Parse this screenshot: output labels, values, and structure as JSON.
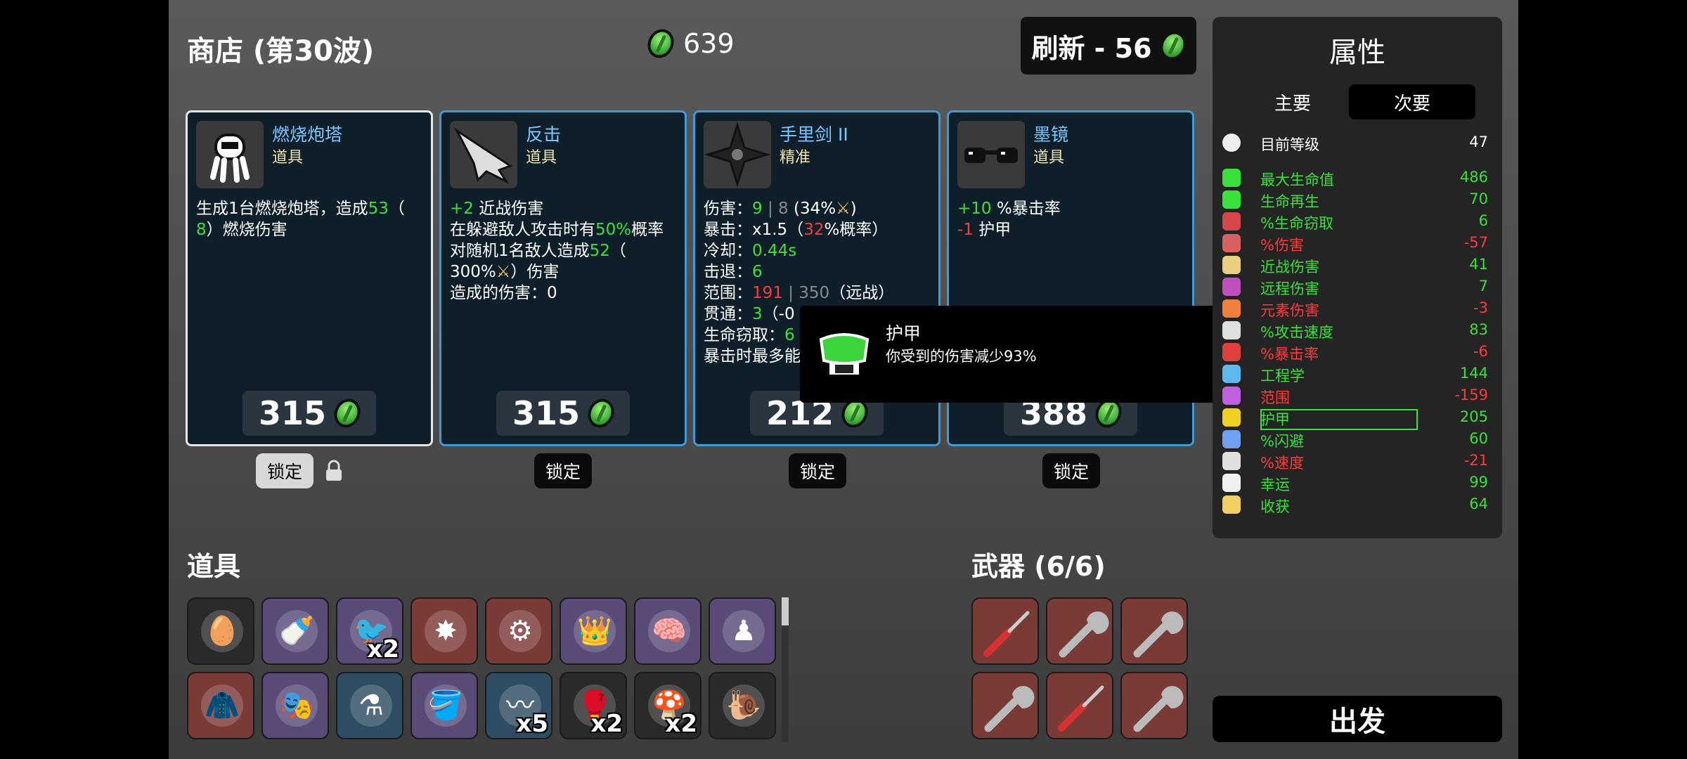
{
  "header": {
    "title": "商店 (第30波)",
    "money": "639",
    "refresh_label": "刷新 - 56"
  },
  "shop": [
    {
      "name": "燃烧炮塔",
      "type": "道具",
      "price": "315",
      "lock": "锁定",
      "desc": [
        [
          "生成1台燃烧炮塔，造成",
          ""
        ],
        [
          "53",
          "g"
        ],
        [
          "（",
          ""
        ],
        [
          "8",
          "g"
        ],
        [
          "）燃烧伤害",
          ""
        ]
      ]
    },
    {
      "name": "反击",
      "type": "道具",
      "price": "315",
      "lock": "锁定"
    },
    {
      "name": "手里剑 II",
      "type": "精准",
      "price": "212",
      "lock": "锁定"
    },
    {
      "name": "墨镜",
      "type": "道具",
      "price": "388",
      "lock": "锁定"
    }
  ],
  "card2": {
    "l1a": "+2",
    "l1b": " 近战伤害",
    "l2a": "在躲避敌人攻击时有",
    "l2b": "50%",
    "l2c": "概率",
    "l3a": "对随机1名敌人造成",
    "l3b": "52",
    "l3c": "（",
    "l4": "300%",
    "l4b": "）伤害",
    "l5": "造成的伤害：0"
  },
  "card3": {
    "dmg_label": "伤害：",
    "dmg": "9",
    "dmg_sep": " | ",
    "dmg_base": "8",
    "dmg_pct": " (34%",
    "crit_label": "暴击：",
    "crit_mult": "x1.5（",
    "crit_chance": "32",
    "crit_tail": "%概率）",
    "cd_label": "冷却：",
    "cd": "0.44s",
    "kb_label": "击退：",
    "kb": "6",
    "range_label": "范围：",
    "range": "191",
    "range_sep": " | ",
    "range_base": "350",
    "range_tail": "（远战）",
    "pierce_label": "贯通：",
    "pierce": "3",
    "pierce_tail": "（-0",
    "ls_label": "生命窃取：",
    "ls": "6",
    "crit_text": "暴击时最多能"
  },
  "card4": {
    "l1a": "+10",
    "l1b": " %暴击率",
    "l2a": "-1",
    "l2b": " 护甲"
  },
  "tooltip": {
    "title": "护甲",
    "desc": "你受到的伤害减少93%"
  },
  "stats": {
    "title": "属性",
    "tab_main": "主要",
    "tab_secondary": "次要",
    "level_label": "目前等级",
    "level": "47",
    "rows": [
      {
        "label": "最大生命值",
        "value": "486",
        "color": "#39e13d",
        "icon": "heart-icon",
        "ic": "#39e13d"
      },
      {
        "label": "生命再生",
        "value": "70",
        "color": "#39e13d",
        "icon": "regen-icon",
        "ic": "#39e13d"
      },
      {
        "label": "%生命窃取",
        "value": "6",
        "color": "#39e13d",
        "icon": "lifesteal-icon",
        "ic": "#d8454a"
      },
      {
        "label": "%伤害",
        "value": "-57",
        "color": "#ff3a3a",
        "icon": "damage-icon",
        "ic": "#d86060"
      },
      {
        "label": "近战伤害",
        "value": "41",
        "color": "#39e13d",
        "icon": "melee-icon",
        "ic": "#e8d080"
      },
      {
        "label": "远程伤害",
        "value": "7",
        "color": "#39e13d",
        "icon": "ranged-icon",
        "ic": "#c050c0"
      },
      {
        "label": "元素伤害",
        "value": "-3",
        "color": "#ff3a3a",
        "icon": "elemental-icon",
        "ic": "#f08040"
      },
      {
        "label": "%攻击速度",
        "value": "83",
        "color": "#39e13d",
        "icon": "attack-speed-icon",
        "ic": "#e0e0e0"
      },
      {
        "label": "%暴击率",
        "value": "-6",
        "color": "#ff3a3a",
        "icon": "crit-icon",
        "ic": "#e04040"
      },
      {
        "label": "工程学",
        "value": "144",
        "color": "#39e13d",
        "icon": "engineering-icon",
        "ic": "#60b8f0"
      },
      {
        "label": "范围",
        "value": "-159",
        "color": "#ff3a3a",
        "icon": "range-icon",
        "ic": "#c060e0"
      },
      {
        "label": "护甲",
        "value": "205",
        "color": "#39e13d",
        "icon": "armor-icon",
        "ic": "#f0d020"
      },
      {
        "label": "%闪避",
        "value": "60",
        "color": "#39e13d",
        "icon": "dodge-icon",
        "ic": "#70a0f0"
      },
      {
        "label": "%速度",
        "value": "-21",
        "color": "#ff3a3a",
        "icon": "speed-icon",
        "ic": "#e0e0e0"
      },
      {
        "label": "幸运",
        "value": "99",
        "color": "#39e13d",
        "icon": "luck-icon",
        "ic": "#f0f0f0"
      },
      {
        "label": "收获",
        "value": "64",
        "color": "#39e13d",
        "icon": "harvest-icon",
        "ic": "#f0d060"
      }
    ]
  },
  "items": {
    "title": "道具",
    "counts": [
      "",
      "",
      "x2",
      "",
      "",
      "",
      "",
      "",
      "",
      "",
      "",
      "",
      "x5",
      "x2",
      "x2",
      ""
    ]
  },
  "weapons": {
    "title": "武器 (6/6)"
  },
  "go_label": "出发"
}
